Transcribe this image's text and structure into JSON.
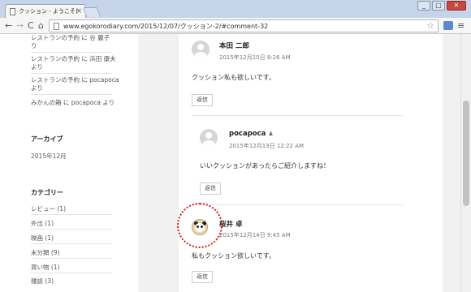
{
  "browser": {
    "tab_title": "クッション - ようこそ日記帳",
    "tab_close": "×",
    "url": "www.egokorodiary.com/2015/12/07/クッション-2/#comment-32",
    "window_buttons": [
      "_",
      "□",
      "✕"
    ],
    "nav": {
      "back": "←",
      "forward": "→",
      "reload": "C",
      "home": "⌂",
      "star": "☆",
      "menu": "≡"
    }
  },
  "sidebar": {
    "recent_comments": [
      {
        "title": "レストランの予約",
        "mid": "に",
        "author": "谷 麗子",
        "suffix": "より",
        "wrapped": "り"
      },
      {
        "title": "レストランの予約",
        "mid": "に",
        "author": "浜田 康夫",
        "suffix": "より",
        "wrapped": "より"
      },
      {
        "title": "レストランの予約",
        "mid": "に",
        "author": "pocapoca",
        "suffix": "より",
        "wrapped": "より"
      },
      {
        "title": "みかんの箱",
        "mid": "に",
        "author": "pocapoca",
        "suffix": "より",
        "wrapped": ""
      }
    ],
    "archive_heading": "アーカイブ",
    "archive_items": [
      "2015年12月"
    ],
    "category_heading": "カテゴリー",
    "categories": [
      "レビュー (1)",
      "外出 (1)",
      "映画 (1)",
      "未分類 (9)",
      "買い物 (1)",
      "雑談 (3)"
    ]
  },
  "comments": [
    {
      "name": "本田 二郎",
      "date": "2015年12月10日 8:26 AM",
      "body": "クッション私も欲しいです。",
      "reply": "返信"
    },
    {
      "name": "pocapoca",
      "date": "2015年12月13日 12:22 AM",
      "body": "いいクッションがあったらご紹介しますね！",
      "reply": "返信"
    },
    {
      "name": "桜井 卓",
      "date": "2015年12月14日 9:45 AM",
      "body": "私もクッション欲しいです。",
      "reply": "返信"
    }
  ],
  "colors": {
    "highlight": "#d61a1a",
    "chrome": "#c6d4ea"
  }
}
